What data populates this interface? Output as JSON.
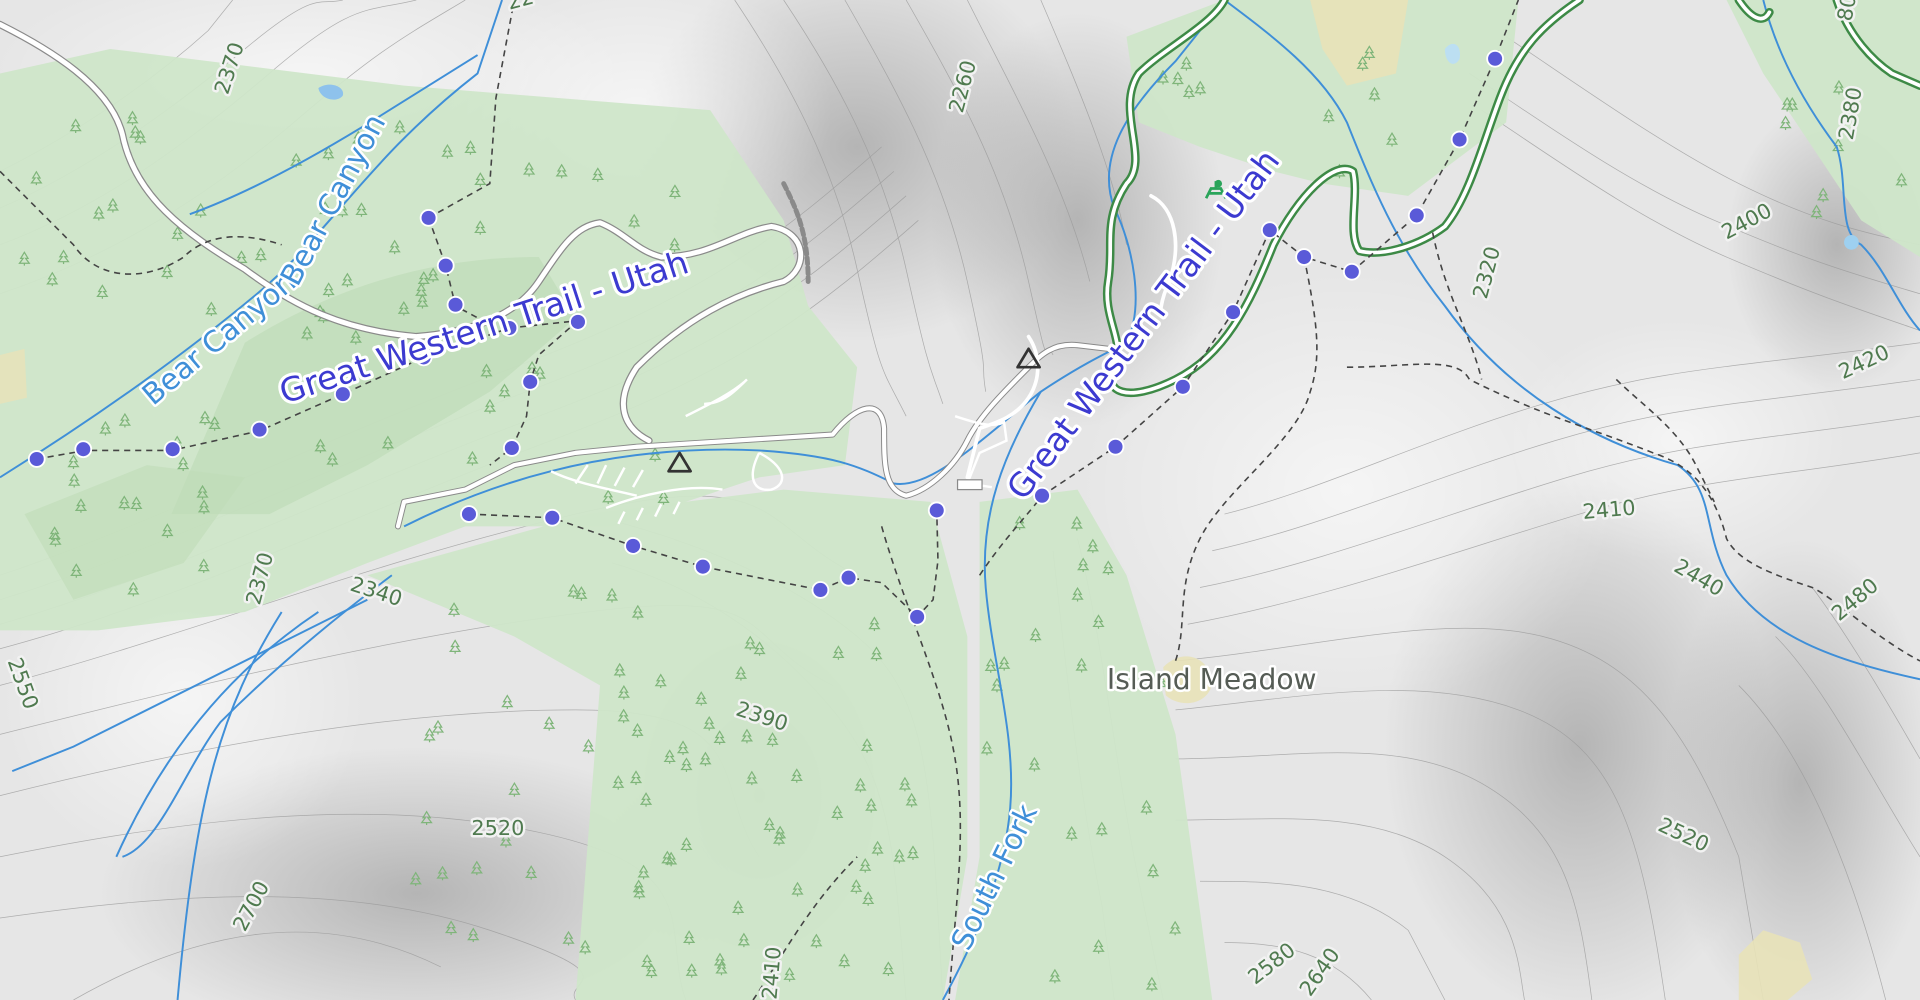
{
  "map": {
    "colors": {
      "terrain": "#e6e6e6",
      "forest": "#cfe6c9",
      "forest_dense": "#bfdcb8",
      "water": "#3f8fd8",
      "road": "#ffffff",
      "highway_outline": "#3d8a46",
      "trail_path": "#444444",
      "trail_marker": "#5a5ad8",
      "contour": "#9a9a9a",
      "contour_label": "#4f7a4f"
    },
    "labels": {
      "bear_canyon_1": "Bear Canyon",
      "bear_canyon_2": "Bear Canyon",
      "great_western_trail_1": "Great Western Trail - Utah",
      "great_western_trail_2": "Great Western Trail - Utah",
      "island_meadow": "Island Meadow",
      "south_fork": "South Fork"
    },
    "contours": {
      "c2370a": "2370",
      "c2260": "2260",
      "c2400": "2400",
      "c2380": "2380",
      "c2320": "2320",
      "c2420": "2420",
      "c2410": "2410",
      "c2440": "2440",
      "c2480": "2480",
      "c2370b": "2370",
      "c2340": "2340",
      "c2550": "2550",
      "c2390": "2390",
      "c2520a": "2520",
      "c2520b": "2520",
      "c2700": "2700",
      "c2580": "2580",
      "c2640": "2640",
      "c2410b": "2410",
      "c22top": "22",
      "c80top": "80"
    },
    "icons": {
      "campground_1": "campground-icon",
      "campground_2": "campground-icon",
      "picnic": "picnic-icon",
      "tree": "tree-icon"
    }
  }
}
